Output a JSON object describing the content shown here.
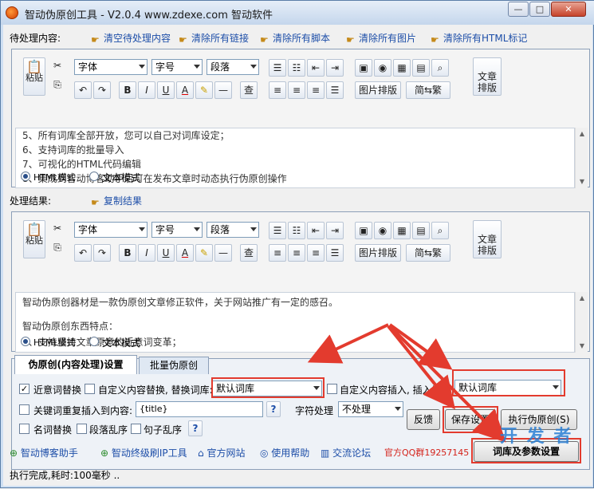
{
  "window": {
    "title": "智动伪原创工具   - V2.0.4  www.zdexe.com 智动软件",
    "minimize": "—",
    "maximize": "□",
    "close": "✕"
  },
  "pending": {
    "label": "待处理内容:",
    "actions": [
      "清空待处理内容",
      "清除所有链接",
      "清除所有脚本",
      "清除所有图片",
      "清除所有HTML标记"
    ],
    "lines": [
      "5、所有词库全部开放，您可以自己对词库设定；",
      "6、支持词库的批量导入",
      "7、可视化的HTML代码编辑",
      "8、集成到智动博客助手后可在发布文章时动态执行伪原创操作"
    ],
    "mode_html": "HTML模式",
    "mode_text": "文本模式"
  },
  "result": {
    "label": "处理结果:",
    "copy": "复制结果",
    "lines": [
      "智动伪原创器材是一款伪原创文章修正软件，关于网站推广有一定的感召。",
      "",
      "智动伪原创东西特点：",
      "1、支持坚持文章原意的近意词变革；"
    ],
    "mode_html": "HTML模式",
    "mode_text": "文本模式"
  },
  "toolbar": {
    "paste": "粘贴",
    "font": "字体",
    "size": "字号",
    "para": "段落",
    "image_layout": "图片排版",
    "trad": "简⇆繁",
    "article_layout_1": "文章",
    "article_layout_2": "排版",
    "bold": "B",
    "italic": "I",
    "underline": "U",
    "fontcolor": "A",
    "find": "查"
  },
  "tabs": {
    "active": "伪原创(内容处理)设置",
    "other": "批量伪原创"
  },
  "settings": {
    "near_replace": "近意词替换",
    "custom_replace": "自定义内容替换, 替换词库:",
    "custom_replace_lib": "默认词库",
    "custom_insert": "自定义内容插入, 插入词库",
    "custom_insert_lib": "默认词库",
    "keyword_insert": "关键词重复插入到内容:",
    "keyword_value": "{title}",
    "help": "?",
    "char_proc_label": "字符处理",
    "char_proc_value": "不处理",
    "name_replace": "名词替换",
    "para_shuffle": "段落乱序",
    "sentence_shuffle": "句子乱序",
    "feedback": "反馈",
    "save": "保存设置",
    "run": "执行伪原创(S)",
    "lib_settings": "词库及参数设置"
  },
  "footer_links": [
    "智动博客助手",
    "智动终级刷IP工具",
    "官方网站",
    "使用帮助",
    "交流论坛"
  ],
  "qq": "官方QQ群19257145",
  "status": "执行完成,耗时:100毫秒 ..",
  "watermark": "开 发 者"
}
